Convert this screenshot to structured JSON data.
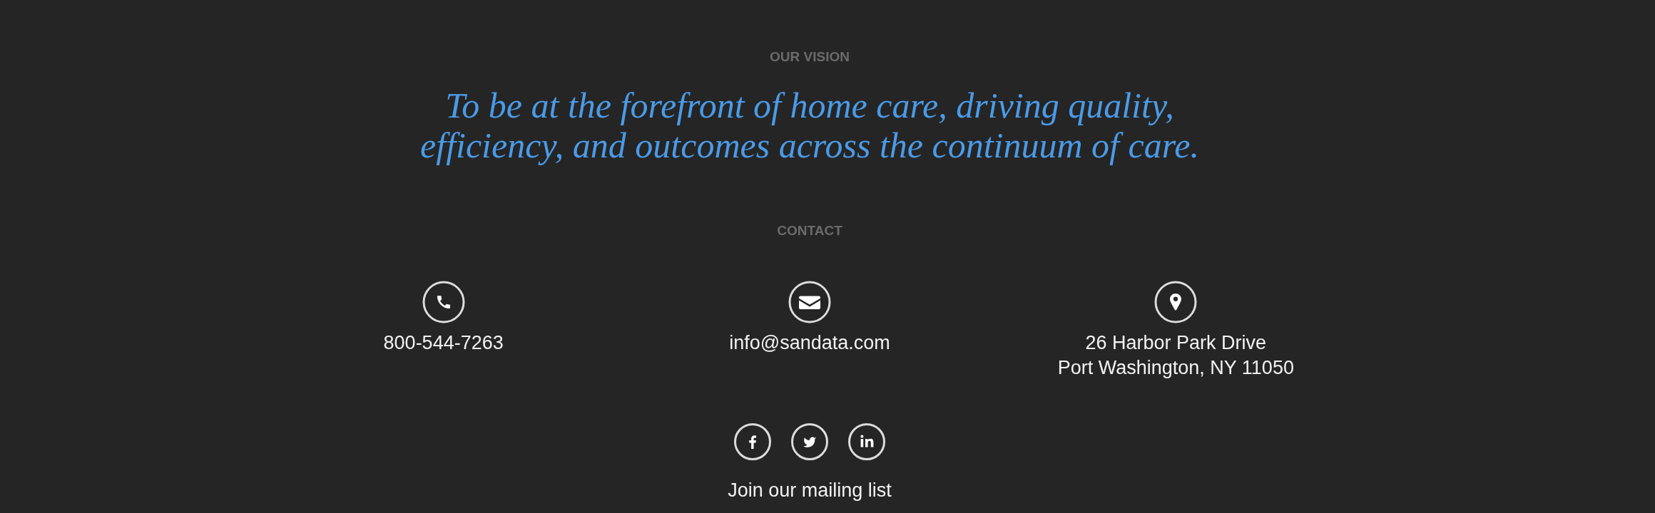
{
  "vision": {
    "heading": "OUR VISION",
    "statement": "To be at the forefront of home care, driving quality, efficiency, and outcomes across the continuum of care."
  },
  "contact": {
    "heading": "CONTACT",
    "items": [
      {
        "kind": "phone",
        "lines": [
          "800-544-7263"
        ]
      },
      {
        "kind": "email",
        "lines": [
          "info@sandata.com"
        ]
      },
      {
        "kind": "address",
        "lines": [
          "26 Harbor Park Drive",
          "Port Washington, NY 11050"
        ]
      }
    ]
  },
  "social": [
    {
      "kind": "facebook"
    },
    {
      "kind": "twitter"
    },
    {
      "kind": "linkedin"
    }
  ],
  "mailing_list": {
    "label": "Join our mailing list"
  }
}
